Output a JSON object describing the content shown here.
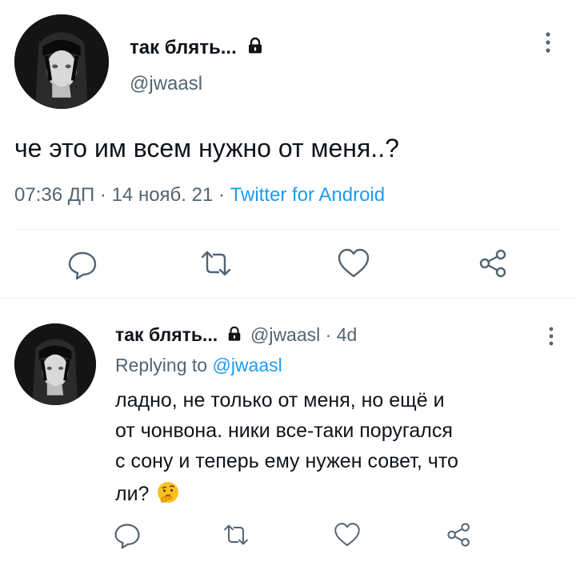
{
  "main_tweet": {
    "display_name": "так блять...",
    "handle": "@jwaasl",
    "text": "че это им всем нужно от меня..?",
    "time": "07:36 ДП",
    "separator": "·",
    "date": "14 нояб. 21",
    "source": "Twitter for Android"
  },
  "reply_tweet": {
    "display_name": "так блять...",
    "handle": "@jwaasl",
    "age": "· 4d",
    "replying_prefix": "Replying to",
    "replying_handle": "@jwaasl",
    "lines": [
      "ладно, не только от меня, но ещё и",
      "от чонвона. ники все-таки поругался",
      "с сону и теперь ему нужен совет, что",
      "ли?"
    ]
  },
  "icons": {
    "reply": "reply-icon",
    "retweet": "retweet-icon",
    "like": "heart-icon",
    "share": "share-icon",
    "lock": "lock-icon",
    "more": "more-vertical-icon",
    "emoji": "thinking-face-emoji"
  },
  "colors": {
    "text": "#0f1419",
    "secondary": "#536471",
    "link": "#1d9bf0",
    "divider": "#eff3f4"
  }
}
